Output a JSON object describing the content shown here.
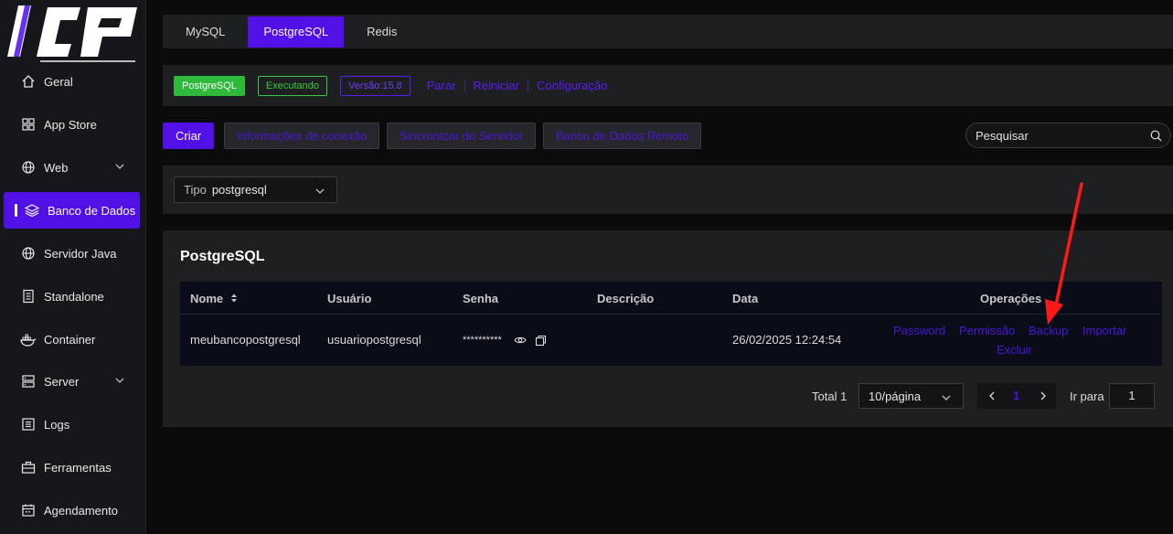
{
  "sidebar": {
    "logo_text": "ICP",
    "items": [
      {
        "label": "Geral",
        "icon": "home-icon"
      },
      {
        "label": "App Store",
        "icon": "grid-icon"
      },
      {
        "label": "Web",
        "icon": "globe-icon",
        "expandable": true
      },
      {
        "label": "Banco de Dados",
        "icon": "layers-icon",
        "active": true
      },
      {
        "label": "Servidor Java",
        "icon": "globe-icon"
      },
      {
        "label": "Standalone",
        "icon": "document-icon"
      },
      {
        "label": "Container",
        "icon": "docker-icon"
      },
      {
        "label": "Server",
        "icon": "server-icon",
        "expandable": true
      },
      {
        "label": "Logs",
        "icon": "list-icon"
      },
      {
        "label": "Ferramentas",
        "icon": "toolbox-icon"
      },
      {
        "label": "Agendamento",
        "icon": "calendar-icon"
      }
    ]
  },
  "tabs": [
    {
      "label": "MySQL"
    },
    {
      "label": "PostgreSQL",
      "active": true
    },
    {
      "label": "Redis"
    }
  ],
  "status": {
    "app_tag": "PostgreSQL",
    "state_tag": "Executando",
    "version_tag": "Versão:15.8",
    "links": [
      "Parar",
      "Reiniciar",
      "Configuração"
    ]
  },
  "toolbar": {
    "create_label": "Criar",
    "connection_info_label": "Informações de conexão",
    "sync_label": "Sincronizar do Servidor",
    "remote_db_label": "Banco de Dados Remoto",
    "search_placeholder": "Pesquisar"
  },
  "filter": {
    "type_label": "Tipo",
    "type_value": "postgresql"
  },
  "content": {
    "title": "PostgreSQL",
    "columns": [
      "Nome",
      "Usuário",
      "Senha",
      "Descrição",
      "Data",
      "Operações"
    ],
    "rows": [
      {
        "name": "meubancopostgresql",
        "user": "usuariopostgresql",
        "password": "**********",
        "description": "",
        "date": "26/02/2025 12:24:54",
        "operations": [
          "Password",
          "Permissão",
          "Backup",
          "Importar",
          "Excluir"
        ]
      }
    ]
  },
  "pagination": {
    "total_label": "Total 1",
    "page_size": "10/página",
    "current_page": "1",
    "goto_label": "Ir para",
    "goto_value": "1"
  },
  "colors": {
    "accent": "#5010e6",
    "running_green": "#2fb93a",
    "annotation_arrow": "#ff1a1a"
  }
}
